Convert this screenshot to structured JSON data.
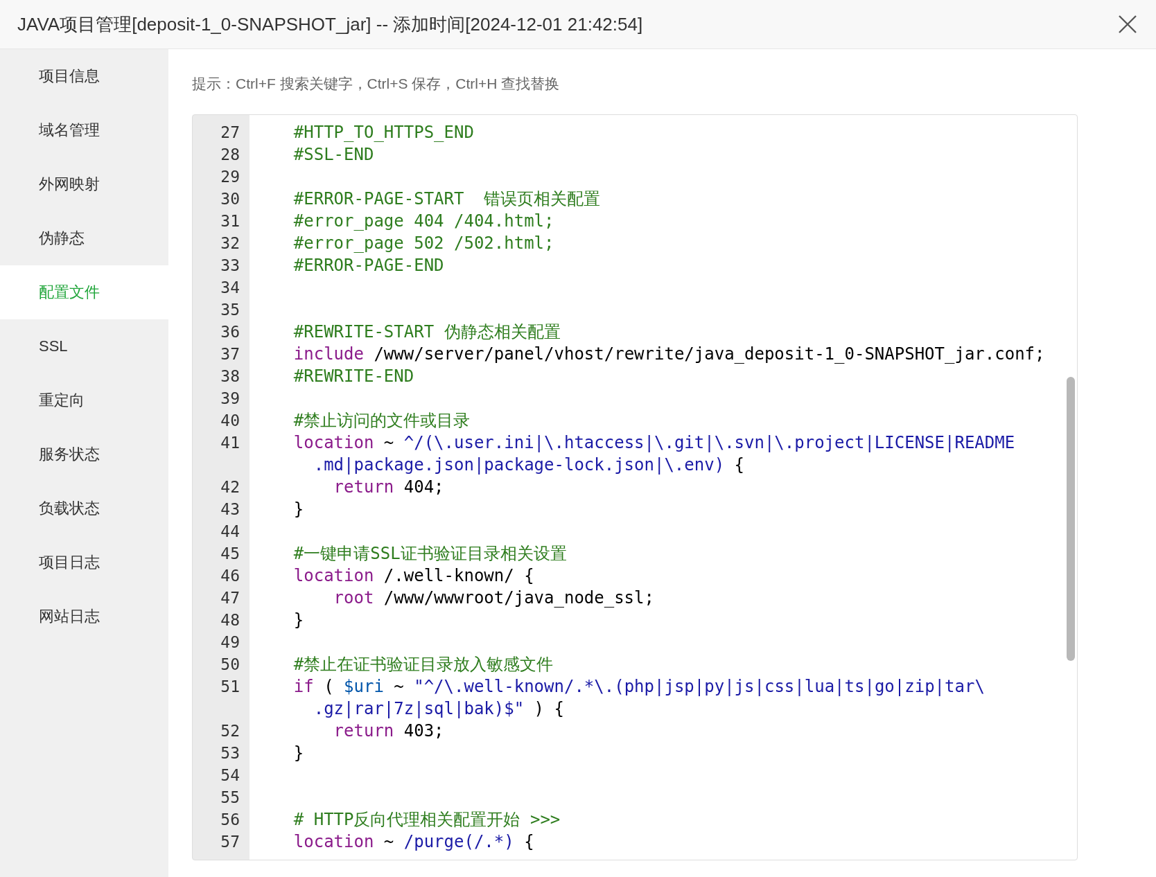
{
  "window": {
    "title": "JAVA项目管理[deposit-1_0-SNAPSHOT_jar] -- 添加时间[2024-12-01 21:42:54]"
  },
  "sidebar": {
    "items": [
      {
        "label": "项目信息",
        "selected": false
      },
      {
        "label": "域名管理",
        "selected": false
      },
      {
        "label": "外网映射",
        "selected": false
      },
      {
        "label": "伪静态",
        "selected": false
      },
      {
        "label": "配置文件",
        "selected": true
      },
      {
        "label": "SSL",
        "selected": false
      },
      {
        "label": "重定向",
        "selected": false
      },
      {
        "label": "服务状态",
        "selected": false
      },
      {
        "label": "负载状态",
        "selected": false
      },
      {
        "label": "项目日志",
        "selected": false
      },
      {
        "label": "网站日志",
        "selected": false
      }
    ]
  },
  "hint": "提示：Ctrl+F 搜索关键字，Ctrl+S 保存，Ctrl+H 查找替换",
  "editor": {
    "lines": [
      {
        "number": "27",
        "tokens": [
          {
            "kind": "comment",
            "text": "    #HTTP_TO_HTTPS_END"
          }
        ]
      },
      {
        "number": "28",
        "tokens": [
          {
            "kind": "comment",
            "text": "    #SSL-END"
          }
        ]
      },
      {
        "number": "29"
      },
      {
        "number": "30",
        "tokens": [
          {
            "kind": "comment",
            "text": "    #ERROR-PAGE-START  错误页相关配置"
          }
        ]
      },
      {
        "number": "31",
        "tokens": [
          {
            "kind": "comment",
            "text": "    #error_page 404 /404.html;"
          }
        ]
      },
      {
        "number": "32",
        "tokens": [
          {
            "kind": "comment",
            "text": "    #error_page 502 /502.html;"
          }
        ]
      },
      {
        "number": "33",
        "tokens": [
          {
            "kind": "comment",
            "text": "    #ERROR-PAGE-END"
          }
        ]
      },
      {
        "number": "34"
      },
      {
        "number": "35"
      },
      {
        "number": "36",
        "tokens": [
          {
            "kind": "comment",
            "text": "    #REWRITE-START 伪静态相关配置"
          }
        ]
      },
      {
        "number": "37",
        "tokens": [
          {
            "kind": "keyword",
            "text": "    include"
          },
          {
            "kind": "plain",
            "text": " /www/server/panel/vhost/rewrite/java_deposit-1_0-SNAPSHOT_jar.conf;"
          }
        ]
      },
      {
        "number": "38",
        "tokens": [
          {
            "kind": "comment",
            "text": "    #REWRITE-END"
          }
        ]
      },
      {
        "number": "39"
      },
      {
        "number": "40",
        "tokens": [
          {
            "kind": "comment",
            "text": "    #禁止访问的文件或目录"
          }
        ]
      },
      {
        "number": "41",
        "tokens": [
          {
            "kind": "keyword",
            "text": "    location"
          },
          {
            "kind": "plain",
            "text": " ~ "
          },
          {
            "kind": "string",
            "text": "^/(\\.user.ini|\\.htaccess|\\.git|\\.svn|\\.project|LICENSE|README"
          }
        ],
        "wrapped": [
          {
            "kind": "string",
            "text": "      .md|package.json|package-lock.json|\\.env)"
          },
          {
            "kind": "plain",
            "text": " {"
          }
        ]
      },
      {
        "number": "42",
        "tokens": [
          {
            "kind": "keyword",
            "text": "        return"
          },
          {
            "kind": "plain",
            "text": " 404;"
          }
        ]
      },
      {
        "number": "43",
        "tokens": [
          {
            "kind": "plain",
            "text": "    }"
          }
        ]
      },
      {
        "number": "44"
      },
      {
        "number": "45",
        "tokens": [
          {
            "kind": "comment",
            "text": "    #一键申请SSL证书验证目录相关设置"
          }
        ]
      },
      {
        "number": "46",
        "tokens": [
          {
            "kind": "keyword",
            "text": "    location"
          },
          {
            "kind": "plain",
            "text": " /.well-known/ {"
          }
        ]
      },
      {
        "number": "47",
        "tokens": [
          {
            "kind": "keyword",
            "text": "        root"
          },
          {
            "kind": "plain",
            "text": " /www/wwwroot/java_node_ssl;"
          }
        ]
      },
      {
        "number": "48",
        "tokens": [
          {
            "kind": "plain",
            "text": "    }"
          }
        ]
      },
      {
        "number": "49"
      },
      {
        "number": "50",
        "tokens": [
          {
            "kind": "comment",
            "text": "    #禁止在证书验证目录放入敏感文件"
          }
        ]
      },
      {
        "number": "51",
        "tokens": [
          {
            "kind": "keyword",
            "text": "    if"
          },
          {
            "kind": "plain",
            "text": " ( "
          },
          {
            "kind": "variable",
            "text": "$uri"
          },
          {
            "kind": "plain",
            "text": " ~ "
          },
          {
            "kind": "string",
            "text": "\"^/\\.well-known/.*\\.(php|jsp|py|js|css|lua|ts|go|zip|tar\\"
          }
        ],
        "wrapped": [
          {
            "kind": "string",
            "text": "      .gz|rar|7z|sql|bak)$\""
          },
          {
            "kind": "plain",
            "text": " ) {"
          }
        ]
      },
      {
        "number": "52",
        "tokens": [
          {
            "kind": "keyword",
            "text": "        return"
          },
          {
            "kind": "plain",
            "text": " 403;"
          }
        ]
      },
      {
        "number": "53",
        "tokens": [
          {
            "kind": "plain",
            "text": "    }"
          }
        ]
      },
      {
        "number": "54"
      },
      {
        "number": "55"
      },
      {
        "number": "56",
        "tokens": [
          {
            "kind": "comment",
            "text": "    # HTTP反向代理相关配置开始 >>>"
          }
        ]
      },
      {
        "number": "57",
        "tokens": [
          {
            "kind": "keyword",
            "text": "    location"
          },
          {
            "kind": "plain",
            "text": " ~ "
          },
          {
            "kind": "string",
            "text": "/purge(/.*)"
          },
          {
            "kind": "plain",
            "text": " {"
          }
        ]
      }
    ]
  }
}
